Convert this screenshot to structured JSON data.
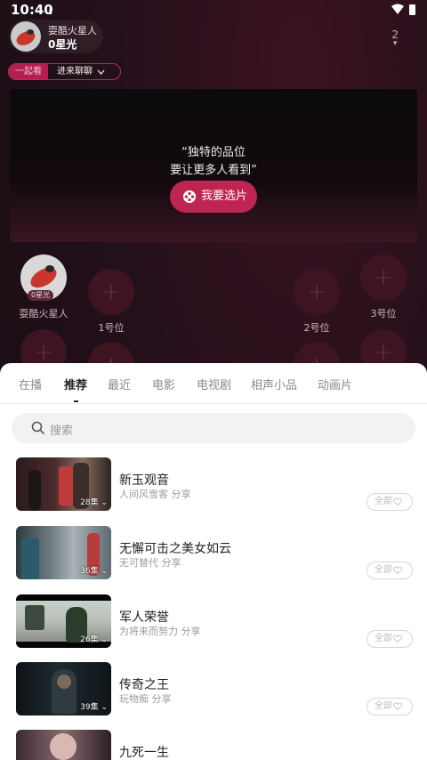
{
  "status_bar": {
    "time": "10:40"
  },
  "host": {
    "name": "耍酷火星人",
    "stars": "0星光"
  },
  "viewer_count": "2",
  "tag": {
    "together": "一起看",
    "chat": "进来聊聊"
  },
  "player": {
    "quote_line1": "“独特的品位",
    "quote_line2": "要让更多人看到”",
    "pick_button": "我要选片"
  },
  "seats": {
    "host_name": "耍酷火星人",
    "host_badge": "0星光",
    "seat1": "1号位",
    "seat2": "2号位",
    "seat3": "3号位"
  },
  "tabs": [
    "在播",
    "推荐",
    "最近",
    "电影",
    "电视剧",
    "相声小品",
    "动画片"
  ],
  "active_tab": "推荐",
  "search": {
    "placeholder": "搜索"
  },
  "videos": [
    {
      "title": "新玉观音",
      "sub": "人间风雪客 分享",
      "episodes": "28集",
      "all_label": "全部"
    },
    {
      "title": "无懈可击之美女如云",
      "sub": "无可替代 分享",
      "episodes": "36集",
      "all_label": "全部"
    },
    {
      "title": "军人荣誉",
      "sub": "为将来而努力 分享",
      "episodes": "26集",
      "all_label": "全部"
    },
    {
      "title": "传奇之王",
      "sub": "玩物痴 分享",
      "episodes": "39集",
      "all_label": "全部"
    },
    {
      "title": "九死一生",
      "sub": "",
      "episodes": "",
      "all_label": ""
    }
  ],
  "colors": {
    "accent": "#bf2553",
    "background": "#23101a",
    "sheet": "#ffffff"
  }
}
